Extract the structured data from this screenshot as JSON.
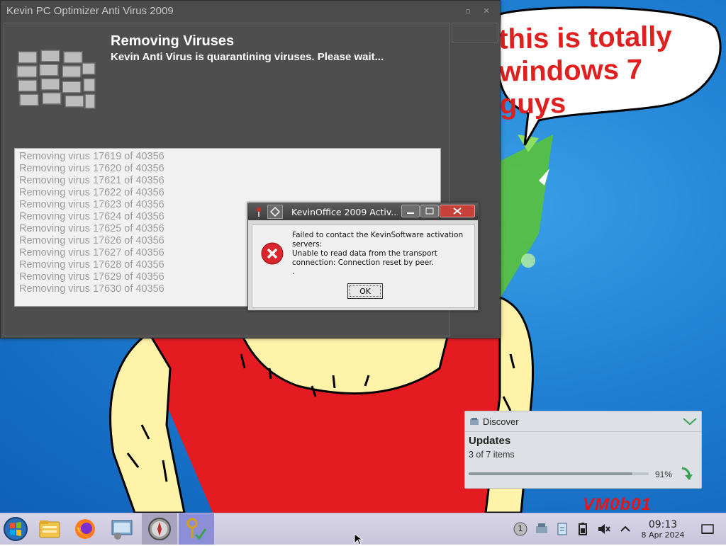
{
  "desktop": {
    "speech_line1": "this is totally",
    "speech_line2": "windows 7 guys",
    "signature": "VM0b01"
  },
  "av_window": {
    "title": "Kevin PC Optimizer Anti Virus 2009",
    "heading": "Removing Viruses",
    "subheading": "Kevin Anti Virus is quarantining viruses. Please wait...",
    "log_lines": [
      "Removing virus 17619 of 40356",
      "Removing virus 17620 of 40356",
      "Removing virus 17621 of 40356",
      "Removing virus 17622 of 40356",
      "Removing virus 17623 of 40356",
      "Removing virus 17624 of 40356",
      "Removing virus 17625 of 40356",
      "Removing virus 17626 of 40356",
      "Removing virus 17627 of 40356",
      "Removing virus 17628 of 40356",
      "Removing virus 17629 of 40356",
      "Removing virus 17630 of 40356"
    ]
  },
  "error_dialog": {
    "title": "KevinOffice 2009 Activ...",
    "message_line1": "Failed to contact the KevinSoftware activation servers:",
    "message_line2": "Unable to read data from the transport connection: Connection reset by peer.",
    "message_line3": ".",
    "ok_label": "OK"
  },
  "notification": {
    "app_name": "Discover",
    "title": "Updates",
    "text": "3 of 7 items",
    "progress_percent": 91,
    "progress_label": "91%"
  },
  "taskbar": {
    "tray_badge": "1",
    "clock_time": "09:13",
    "clock_date": "8 Apr 2024"
  },
  "colors": {
    "speech_text": "#e02020",
    "av_background": "#4b4b4b",
    "taskbar": "#d3d0e4"
  }
}
